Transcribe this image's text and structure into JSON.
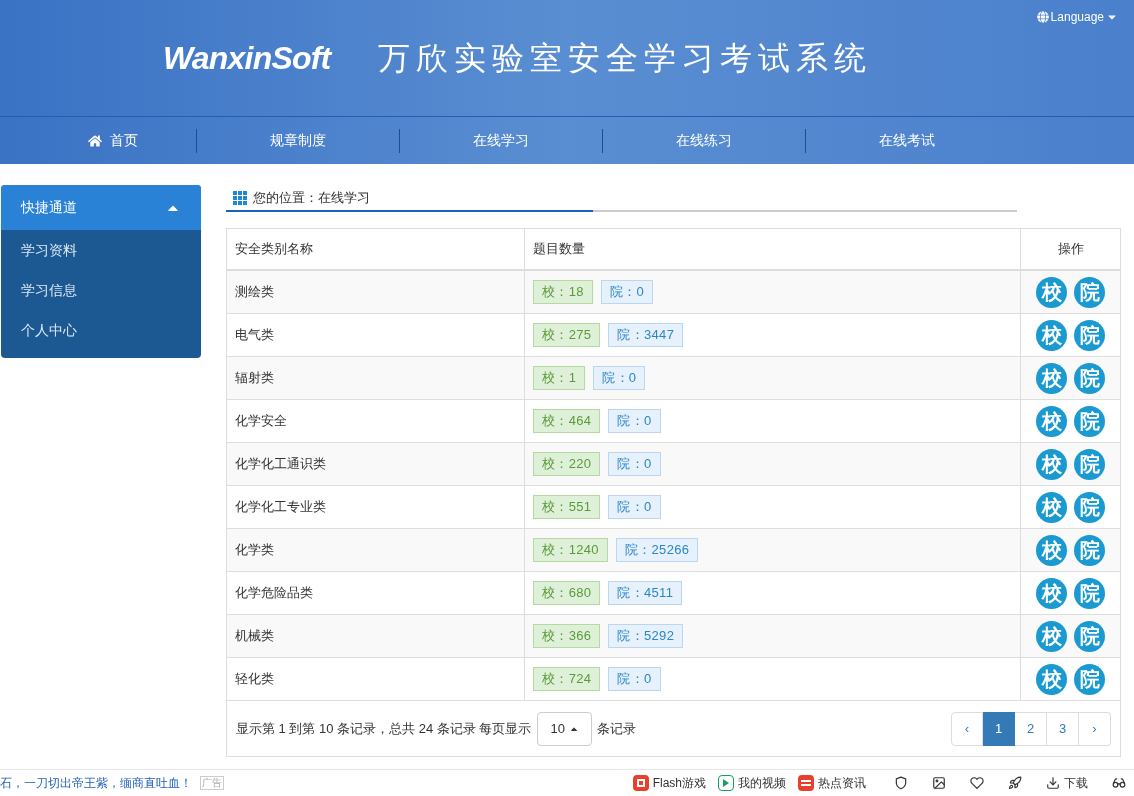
{
  "header": {
    "logo": "WanxinSoft",
    "title": "万欣实验室安全学习考试系统",
    "language": "Language"
  },
  "nav": [
    {
      "label": "首页"
    },
    {
      "label": "规章制度"
    },
    {
      "label": "在线学习"
    },
    {
      "label": "在线练习"
    },
    {
      "label": "在线考试"
    }
  ],
  "sidebar": {
    "title": "快捷通道",
    "expanded": true,
    "items": [
      "学习资料",
      "学习信息",
      "个人中心"
    ]
  },
  "breadcrumb": {
    "label": "您的位置：",
    "current": "在线学习"
  },
  "table": {
    "columns": [
      "安全类别名称",
      "题目数量",
      "操作"
    ],
    "rows": [
      {
        "name": "测绘类",
        "school": "校：18",
        "college": "院：0",
        "actions": [
          "校",
          "院"
        ]
      },
      {
        "name": "电气类",
        "school": "校：275",
        "college": "院：3447",
        "actions": [
          "校",
          "院"
        ]
      },
      {
        "name": "辐射类",
        "school": "校：1",
        "college": "院：0",
        "actions": [
          "校",
          "院"
        ]
      },
      {
        "name": "化学安全",
        "school": "校：464",
        "college": "院：0",
        "actions": [
          "校",
          "院"
        ]
      },
      {
        "name": "化学化工通识类",
        "school": "校：220",
        "college": "院：0",
        "actions": [
          "校",
          "院"
        ]
      },
      {
        "name": "化学化工专业类",
        "school": "校：551",
        "college": "院：0",
        "actions": [
          "校",
          "院"
        ]
      },
      {
        "name": "化学类",
        "school": "校：1240",
        "college": "院：25266",
        "actions": [
          "校",
          "院"
        ]
      },
      {
        "name": "化学危险品类",
        "school": "校：680",
        "college": "院：4511",
        "actions": [
          "校",
          "院"
        ]
      },
      {
        "name": "机械类",
        "school": "校：366",
        "college": "院：5292",
        "actions": [
          "校",
          "院"
        ]
      },
      {
        "name": "轻化类",
        "school": "校：724",
        "college": "院：0",
        "actions": [
          "校",
          "院"
        ]
      }
    ]
  },
  "pagination": {
    "summary": "显示第 1 到第 10 条记录，总共 24 条记录 每页显示",
    "page_size": "10",
    "suffix": "条记录",
    "prev": "‹",
    "next": "›",
    "pages": [
      {
        "label": "1",
        "selected": true
      },
      {
        "label": "2",
        "selected": false
      },
      {
        "label": "3",
        "selected": false
      }
    ]
  },
  "browser_bar": {
    "news": "石，一刀切出帝王紫，缅商直吐血！",
    "ad": "广告",
    "links": [
      {
        "label": "Flash游戏"
      },
      {
        "label": "我的视频"
      },
      {
        "label": "热点资讯"
      }
    ],
    "download": "下载"
  }
}
